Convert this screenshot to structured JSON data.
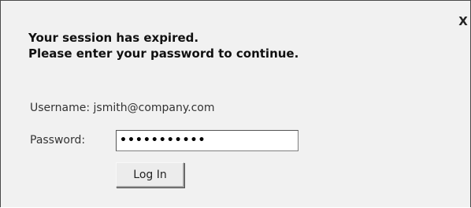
{
  "dialog": {
    "close_label": "X",
    "message_line1": "Your session has expired.",
    "message_line2": "Please enter your password to continue.",
    "username_label": "Username:",
    "username_value": "jsmith@company.com",
    "password_label": "Password:",
    "password_value": "•••••••••••",
    "login_button": "Log In"
  }
}
